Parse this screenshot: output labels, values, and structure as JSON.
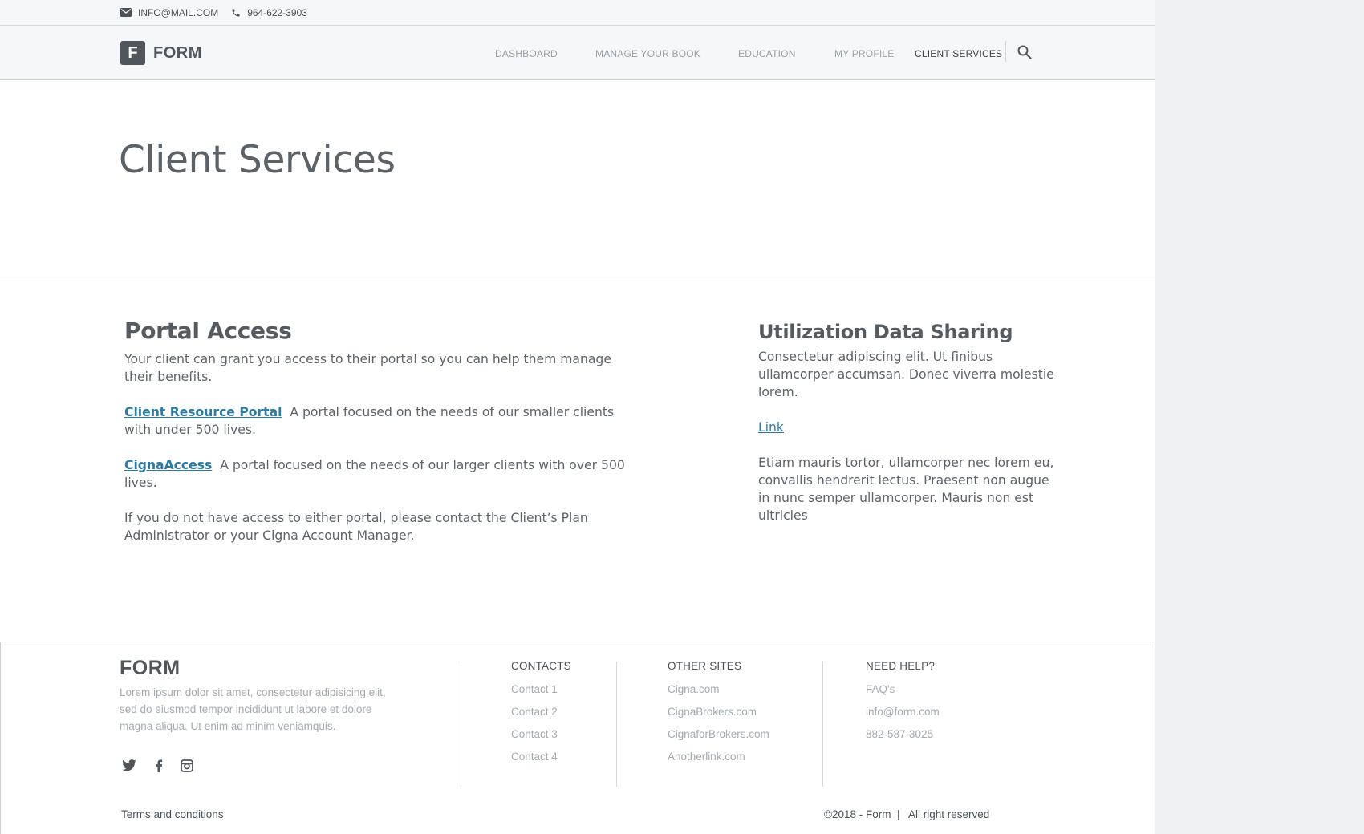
{
  "topbar": {
    "email": "INFO@MAIL.COM",
    "phone": "964-622-3903"
  },
  "navbar": {
    "logo_letter": "F",
    "logo_text": "FORM",
    "items": [
      {
        "label": "DASHBOARD"
      },
      {
        "label": "MANAGE YOUR BOOK"
      },
      {
        "label": "EDUCATION"
      },
      {
        "label": "MY PROFILE"
      },
      {
        "label": "CLIENT SERVICES"
      }
    ],
    "active_item": "CLIENT SERVICES",
    "search_icon": "search-icon"
  },
  "hero": {
    "title": "Client Services"
  },
  "portal_access": {
    "title": "Portal Access",
    "intro": "Your client can grant you access to their portal so you can help them manage their benefits.",
    "link1_label": "Client Resource Portal",
    "link1_text": "A portal focused on the needs of our smaller clients with under 500 lives.",
    "link2_label": "CignaAccess",
    "link2_text": "A portal focused on the needs of our larger clients with over 500 lives.",
    "outro": "If you do not have access to either portal, please contact the Client’s Plan Administrator or your Cigna Account Manager."
  },
  "utilization": {
    "title": "Utilization Data Sharing",
    "para1": "Consectetur adipiscing elit. Ut finibus ullamcorper accumsan. Donec viverra molestie lorem.",
    "link_label": "Link",
    "para2": "Etiam mauris tortor, ullamcorper nec lorem eu, convallis hendrerit lectus. Praesent non augue in nunc semper ullamcorper. Mauris non est ultricies"
  },
  "footer": {
    "logo_text": "FORM",
    "description": "Lorem ipsum dolor sit amet, consectetur adipisicing elit, sed do eiusmod tempor incididunt ut labore et dolore magna aliqua. Ut enim ad minim veniamquis.",
    "social": [
      "twitter-icon",
      "facebook-icon",
      "instagram-icon"
    ],
    "contacts": {
      "heading": "CONTACTS",
      "items": [
        "Contact 1",
        "Contact 2",
        "Contact 3",
        "Contact 4"
      ]
    },
    "other_sites": {
      "heading": "OTHER SITES",
      "items": [
        "Cigna.com",
        "CignaBrokers.com",
        "CignaforBrokers.com",
        "Anotherlink.com"
      ]
    },
    "need_help": {
      "heading": "NEED HELP?",
      "items": [
        "FAQ's",
        "info@form.com",
        "882-587-3025"
      ]
    }
  },
  "bottombar": {
    "terms": "Terms and conditions",
    "copyright": "©2018 - Form  |   All right reserved"
  }
}
